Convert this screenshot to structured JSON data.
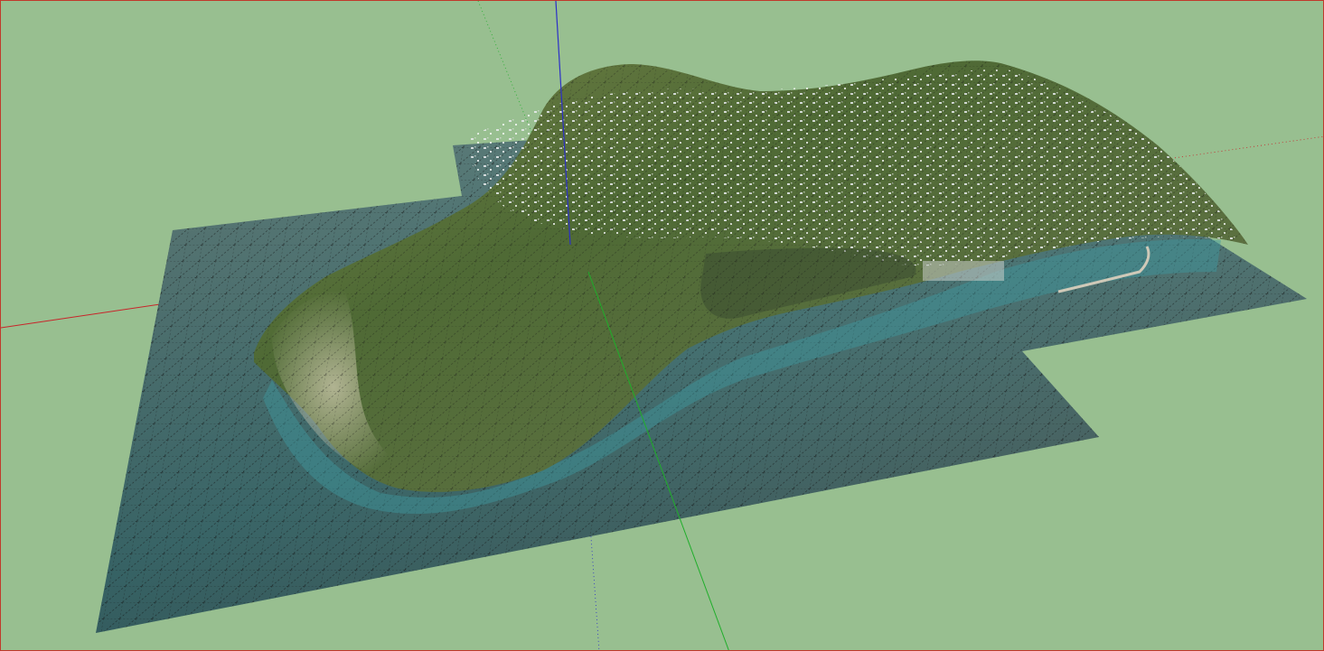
{
  "viewport": {
    "colors": {
      "sky_ground": "#98bf90",
      "frame": "#c0392b",
      "axis_red": "#c8242a",
      "axis_green": "#1fae2a",
      "axis_blue": "#2b2fc8",
      "sea": "#3f6f6f",
      "terrain": "#4f6a35",
      "grid": "#111111"
    },
    "icons": [
      "axis-red-icon",
      "axis-green-icon",
      "axis-blue-icon"
    ]
  }
}
